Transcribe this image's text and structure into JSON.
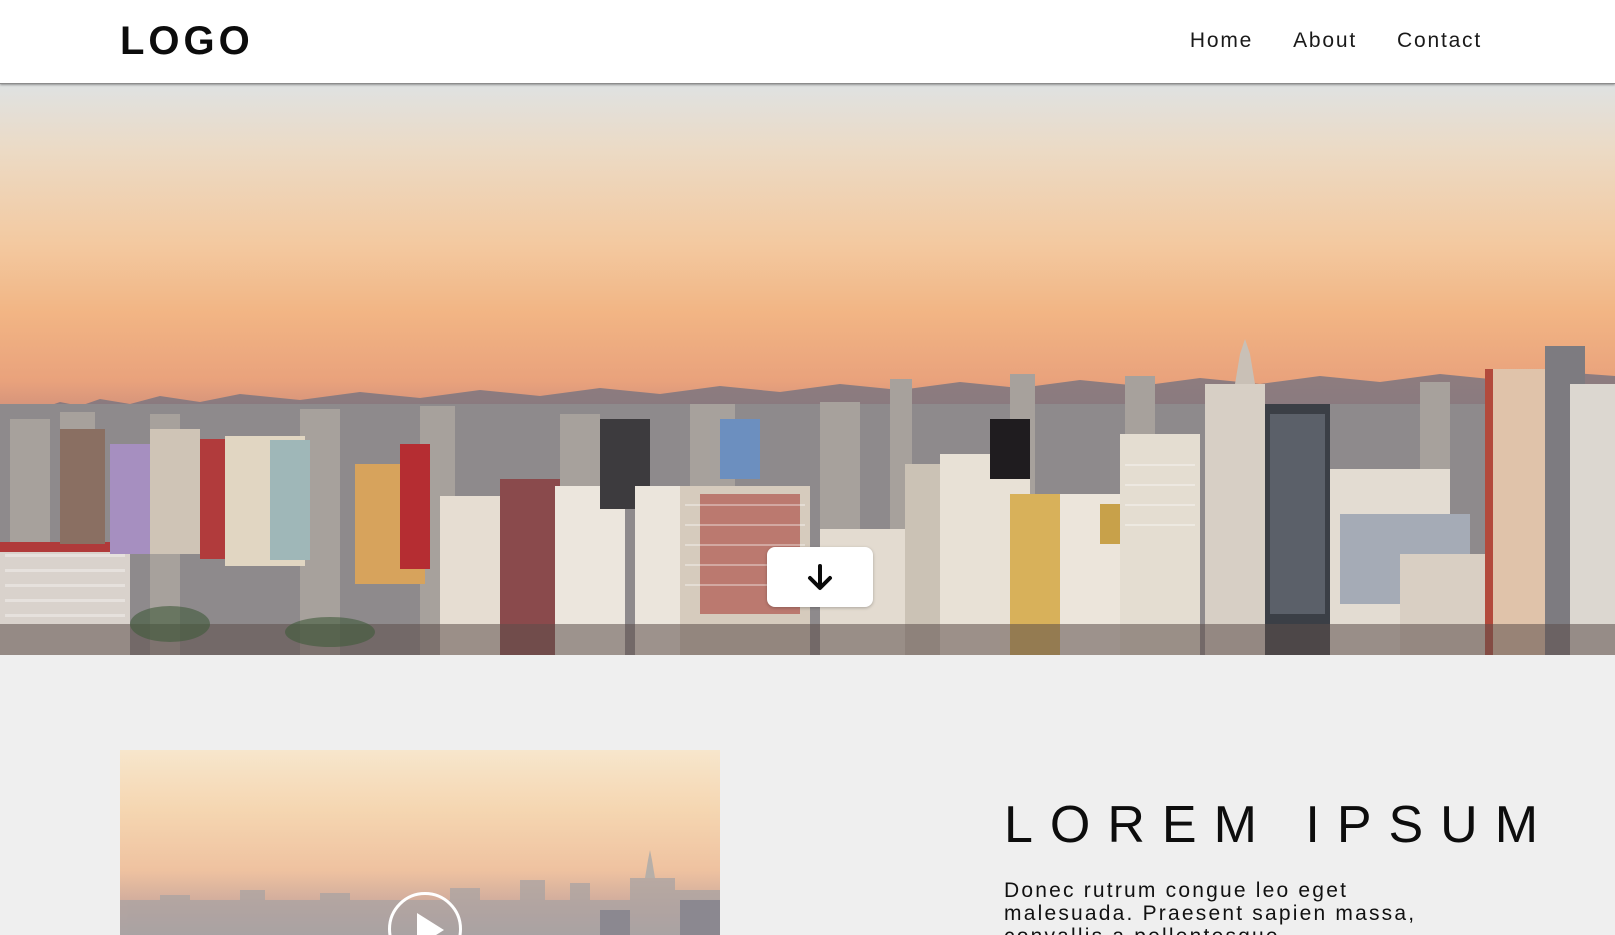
{
  "header": {
    "logo": "LOGO",
    "nav": [
      {
        "label": "Home"
      },
      {
        "label": "About"
      },
      {
        "label": "Contact"
      }
    ]
  },
  "hero": {
    "image": "city-skyline-sunset",
    "scroll_button_icon": "arrow-down-icon"
  },
  "feature": {
    "video_thumbnail": "city-skyline-sunset",
    "play_icon": "play-icon",
    "heading": "LOREM IPSUM",
    "body": "Donec rutrum congue leo eget malesuada. Praesent sapien massa, convallis a pellentesque"
  },
  "colors": {
    "header_bg": "#ffffff",
    "page_bg": "#efefef",
    "text": "#111111"
  }
}
